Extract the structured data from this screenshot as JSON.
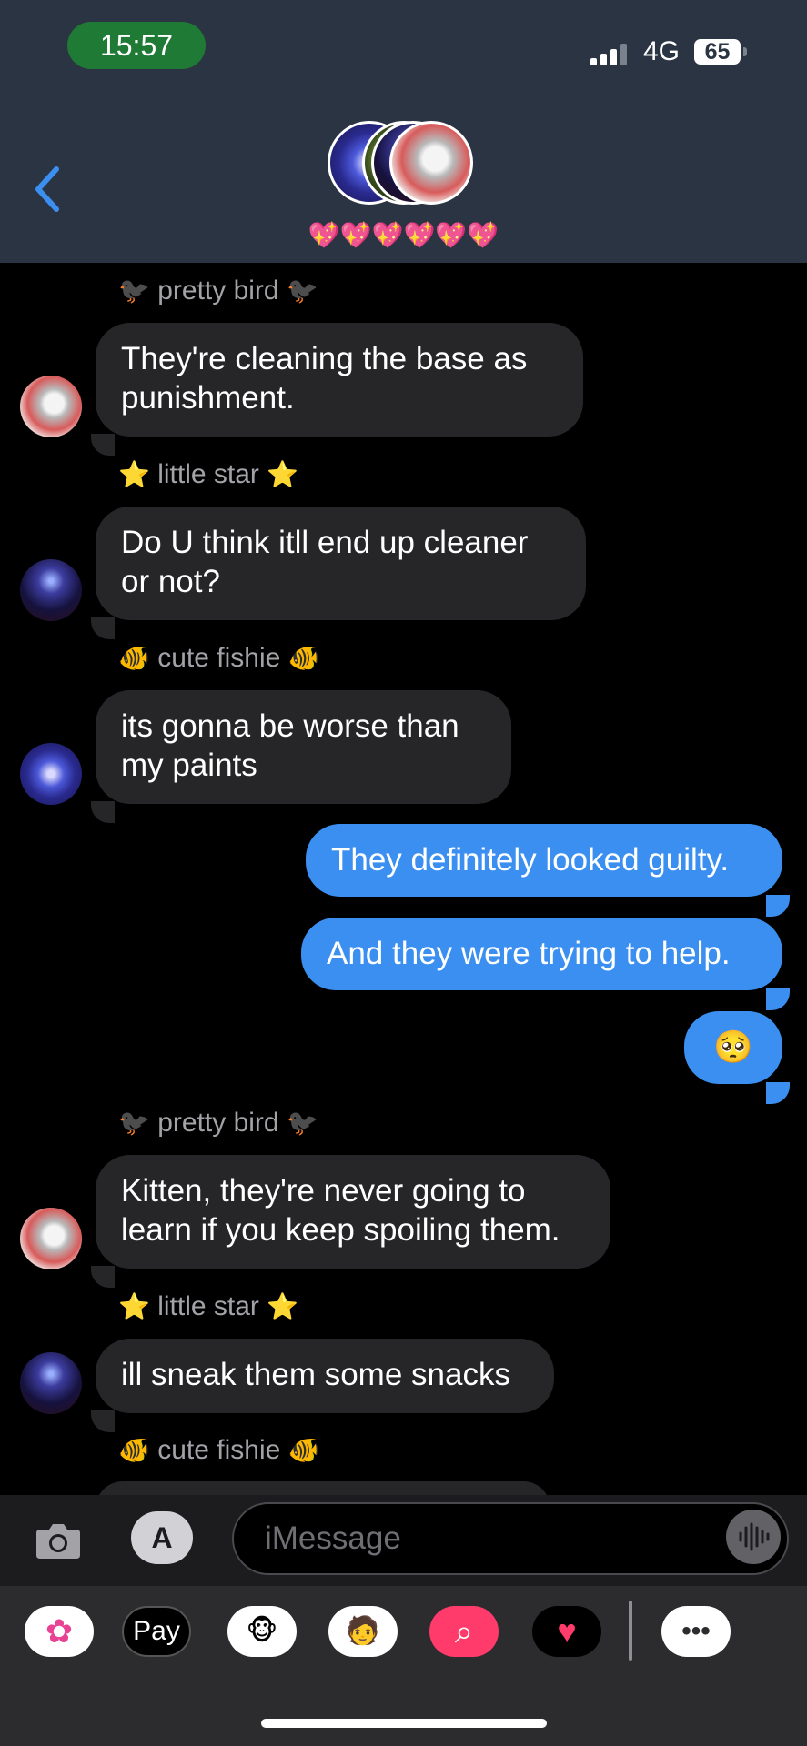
{
  "status_bar": {
    "time": "15:57",
    "network": "4G",
    "battery": "65"
  },
  "header": {
    "group_name": "💖💖💖💖💖💖",
    "back_icon": "chevron-left-icon"
  },
  "messages": [
    {
      "type": "sender",
      "text": "pretty bird",
      "emoji": "🐦‍⬛"
    },
    {
      "type": "incoming",
      "avatar": "cat",
      "lines": [
        "They're cleaning the base as",
        "punishment."
      ]
    },
    {
      "type": "sender",
      "text": "little star",
      "emoji": "⭐"
    },
    {
      "type": "incoming",
      "avatar": "night",
      "lines": [
        "Do U think itll end up cleaner",
        "or not?"
      ]
    },
    {
      "type": "sender",
      "text": "cute fishie",
      "emoji": "🐠"
    },
    {
      "type": "incoming",
      "avatar": "fish",
      "lines": [
        "its gonna be worse than",
        "my paints"
      ]
    },
    {
      "type": "outgoing",
      "lines": [
        "They definitely looked guilty."
      ]
    },
    {
      "type": "outgoing",
      "lines": [
        "And they were trying to help."
      ]
    },
    {
      "type": "outgoing",
      "lines": [
        "🥺"
      ]
    },
    {
      "type": "sender",
      "text": "pretty bird",
      "emoji": "🐦‍⬛"
    },
    {
      "type": "incoming",
      "avatar": "cat",
      "lines": [
        "Kitten, they're never going to",
        "learn if you keep spoiling them."
      ]
    },
    {
      "type": "sender",
      "text": "little star",
      "emoji": "⭐"
    },
    {
      "type": "incoming",
      "avatar": "night",
      "lines": [
        "ill sneak them some snacks"
      ]
    },
    {
      "type": "sender",
      "text": "cute fishie",
      "emoji": "🐠"
    }
  ],
  "composer": {
    "placeholder": "iMessage",
    "camera_icon": "camera-icon",
    "apps_icon": "app-store-icon",
    "audio_icon": "audio-waveform-icon"
  },
  "tray": [
    {
      "name": "photos-app",
      "label": "✿",
      "color": "#ffffff"
    },
    {
      "name": "apple-pay-app",
      "label": "Pay",
      "color": "#000000"
    },
    {
      "name": "animoji-app",
      "label": "🐵",
      "color": "#ffffff"
    },
    {
      "name": "memoji-app",
      "label": "🧑",
      "color": "#ffffff"
    },
    {
      "name": "search-images-app",
      "label": "⌕",
      "color": "#ff3b6b"
    },
    {
      "name": "digital-touch-app",
      "label": "♥",
      "color": "#000000"
    },
    {
      "name": "more-apps",
      "label": "•••",
      "color": "#ffffff"
    }
  ]
}
